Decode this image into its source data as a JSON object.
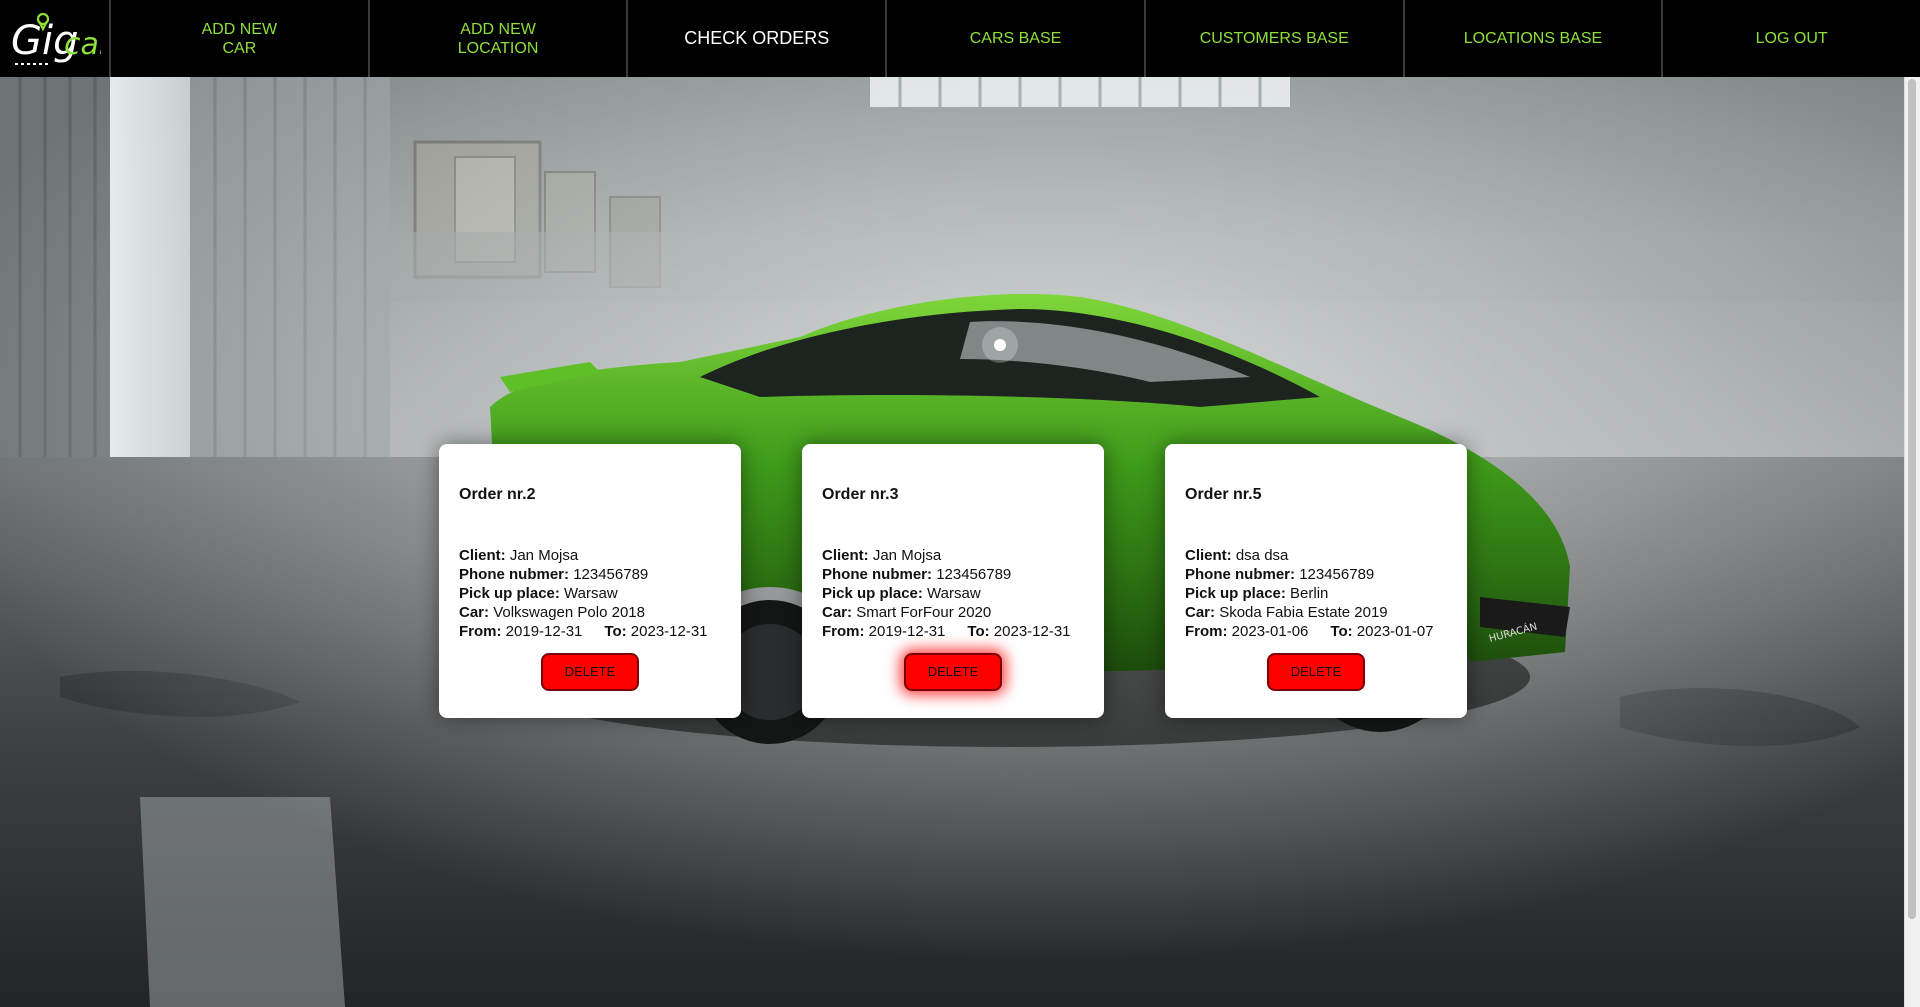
{
  "brand": {
    "logo_text_a": "Gig",
    "logo_text_b": "car",
    "accent": "#8fe03a"
  },
  "nav": {
    "items": [
      {
        "label": "ADD NEW CAR"
      },
      {
        "label": "ADD NEW LOCATION"
      },
      {
        "label": "CHECK ORDERS",
        "active": true
      },
      {
        "label": "CARS BASE"
      },
      {
        "label": "CUSTOMERS BASE"
      },
      {
        "label": "LOCATIONS BASE"
      },
      {
        "label": "LOG OUT"
      }
    ]
  },
  "labels": {
    "client": "Client:",
    "phone": "Phone nubmer:",
    "pickup": "Pick up place:",
    "car": "Car:",
    "from": "From:",
    "to": "To:",
    "delete": "DELETE"
  },
  "orders": [
    {
      "title": "Order nr.2",
      "client": "Jan Mojsa",
      "phone": "123456789",
      "pickup": "Warsaw",
      "car": "Volkswagen Polo 2018",
      "from": "2019-12-31",
      "to": "2023-12-31"
    },
    {
      "title": "Order nr.3",
      "client": "Jan Mojsa",
      "phone": "123456789",
      "pickup": "Warsaw",
      "car": "Smart ForFour 2020",
      "from": "2019-12-31",
      "to": "2023-12-31"
    },
    {
      "title": "Order nr.5",
      "client": "dsa dsa",
      "phone": "123456789",
      "pickup": "Berlin",
      "car": "Skoda Fabia Estate 2019",
      "from": "2023-01-06",
      "to": "2023-01-07"
    }
  ],
  "hero": {
    "car_badge": "HURACÁN"
  }
}
